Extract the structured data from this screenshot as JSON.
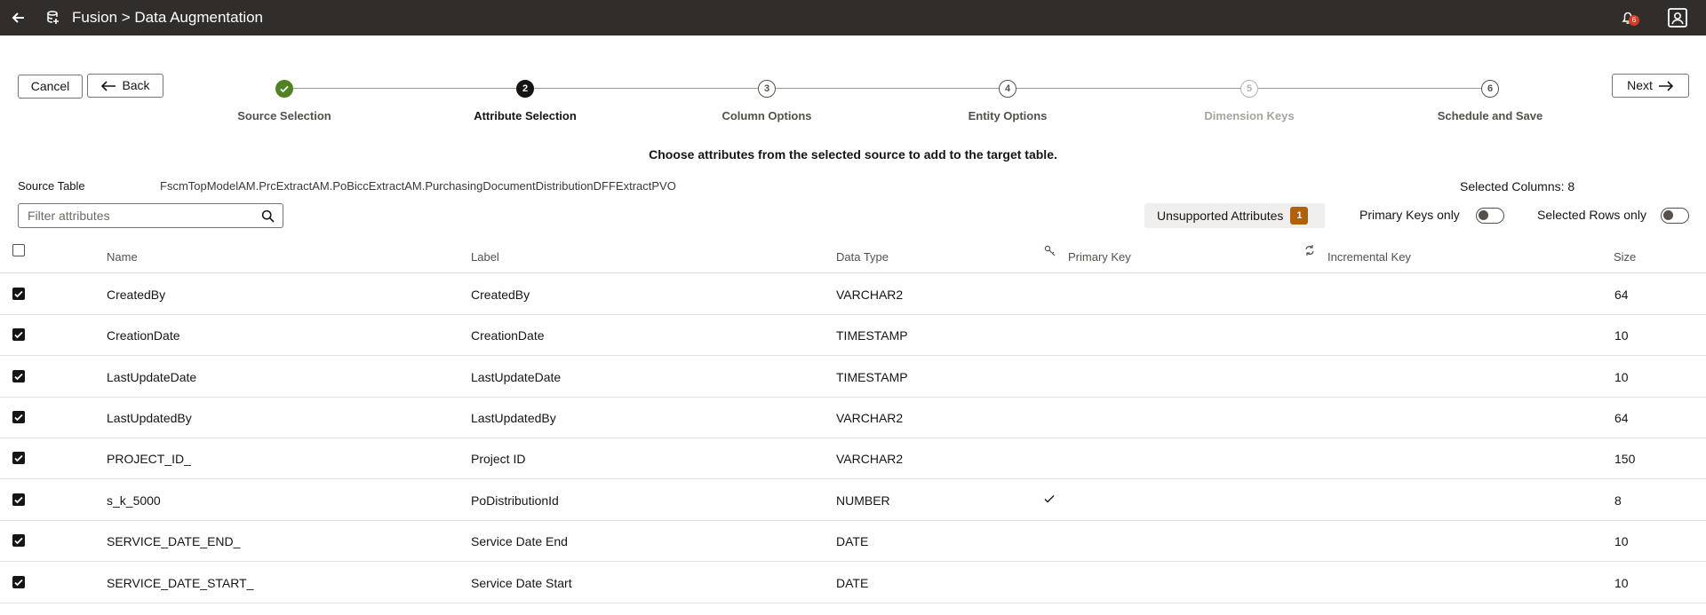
{
  "header": {
    "title": "Fusion > Data Augmentation",
    "notification_count": "6"
  },
  "buttons": {
    "cancel": "Cancel",
    "back": "Back",
    "next": "Next"
  },
  "steps": [
    {
      "number": "1",
      "label": "Source Selection",
      "state": "done"
    },
    {
      "number": "2",
      "label": "Attribute Selection",
      "state": "active"
    },
    {
      "number": "3",
      "label": "Column Options",
      "state": "future"
    },
    {
      "number": "4",
      "label": "Entity Options",
      "state": "future"
    },
    {
      "number": "5",
      "label": "Dimension Keys",
      "state": "disabled"
    },
    {
      "number": "6",
      "label": "Schedule and Save",
      "state": "future"
    }
  ],
  "instruction": "Choose attributes from the selected source to add to the target table.",
  "source": {
    "label": "Source Table",
    "value": "FscmTopModelAM.PrcExtractAM.PoBiccExtractAM.PurchasingDocumentDistributionDFFExtractPVO"
  },
  "selected_columns": {
    "label": "Selected Columns:",
    "count": "8"
  },
  "filter": {
    "placeholder": "Filter attributes",
    "value": ""
  },
  "unsupported": {
    "label": "Unsupported Attributes",
    "count": "1"
  },
  "toggles": {
    "primary_keys_only": "Primary Keys only",
    "selected_rows_only": "Selected Rows only"
  },
  "table": {
    "columns": {
      "name": "Name",
      "label": "Label",
      "data_type": "Data Type",
      "primary_key": "Primary Key",
      "incremental_key": "Incremental Key",
      "size": "Size"
    },
    "rows": [
      {
        "name": "CreatedBy",
        "label": "CreatedBy",
        "data_type": "VARCHAR2",
        "primary_key": false,
        "size": "64",
        "checked": true
      },
      {
        "name": "CreationDate",
        "label": "CreationDate",
        "data_type": "TIMESTAMP",
        "primary_key": false,
        "size": "10",
        "checked": true
      },
      {
        "name": "LastUpdateDate",
        "label": "LastUpdateDate",
        "data_type": "TIMESTAMP",
        "primary_key": false,
        "size": "10",
        "checked": true
      },
      {
        "name": "LastUpdatedBy",
        "label": "LastUpdatedBy",
        "data_type": "VARCHAR2",
        "primary_key": false,
        "size": "64",
        "checked": true
      },
      {
        "name": "PROJECT_ID_",
        "label": "Project ID",
        "data_type": "VARCHAR2",
        "primary_key": false,
        "size": "150",
        "checked": true
      },
      {
        "name": "s_k_5000",
        "label": "PoDistributionId",
        "data_type": "NUMBER",
        "primary_key": true,
        "size": "8",
        "checked": true
      },
      {
        "name": "SERVICE_DATE_END_",
        "label": "Service Date End",
        "data_type": "DATE",
        "primary_key": false,
        "size": "10",
        "checked": true
      },
      {
        "name": "SERVICE_DATE_START_",
        "label": "Service Date Start",
        "data_type": "DATE",
        "primary_key": false,
        "size": "10",
        "checked": true
      }
    ]
  },
  "colors": {
    "topbar": "#312d2a",
    "step_done": "#508223",
    "unsupported_badge": "#ac630c",
    "notification_badge": "#d63b25"
  }
}
